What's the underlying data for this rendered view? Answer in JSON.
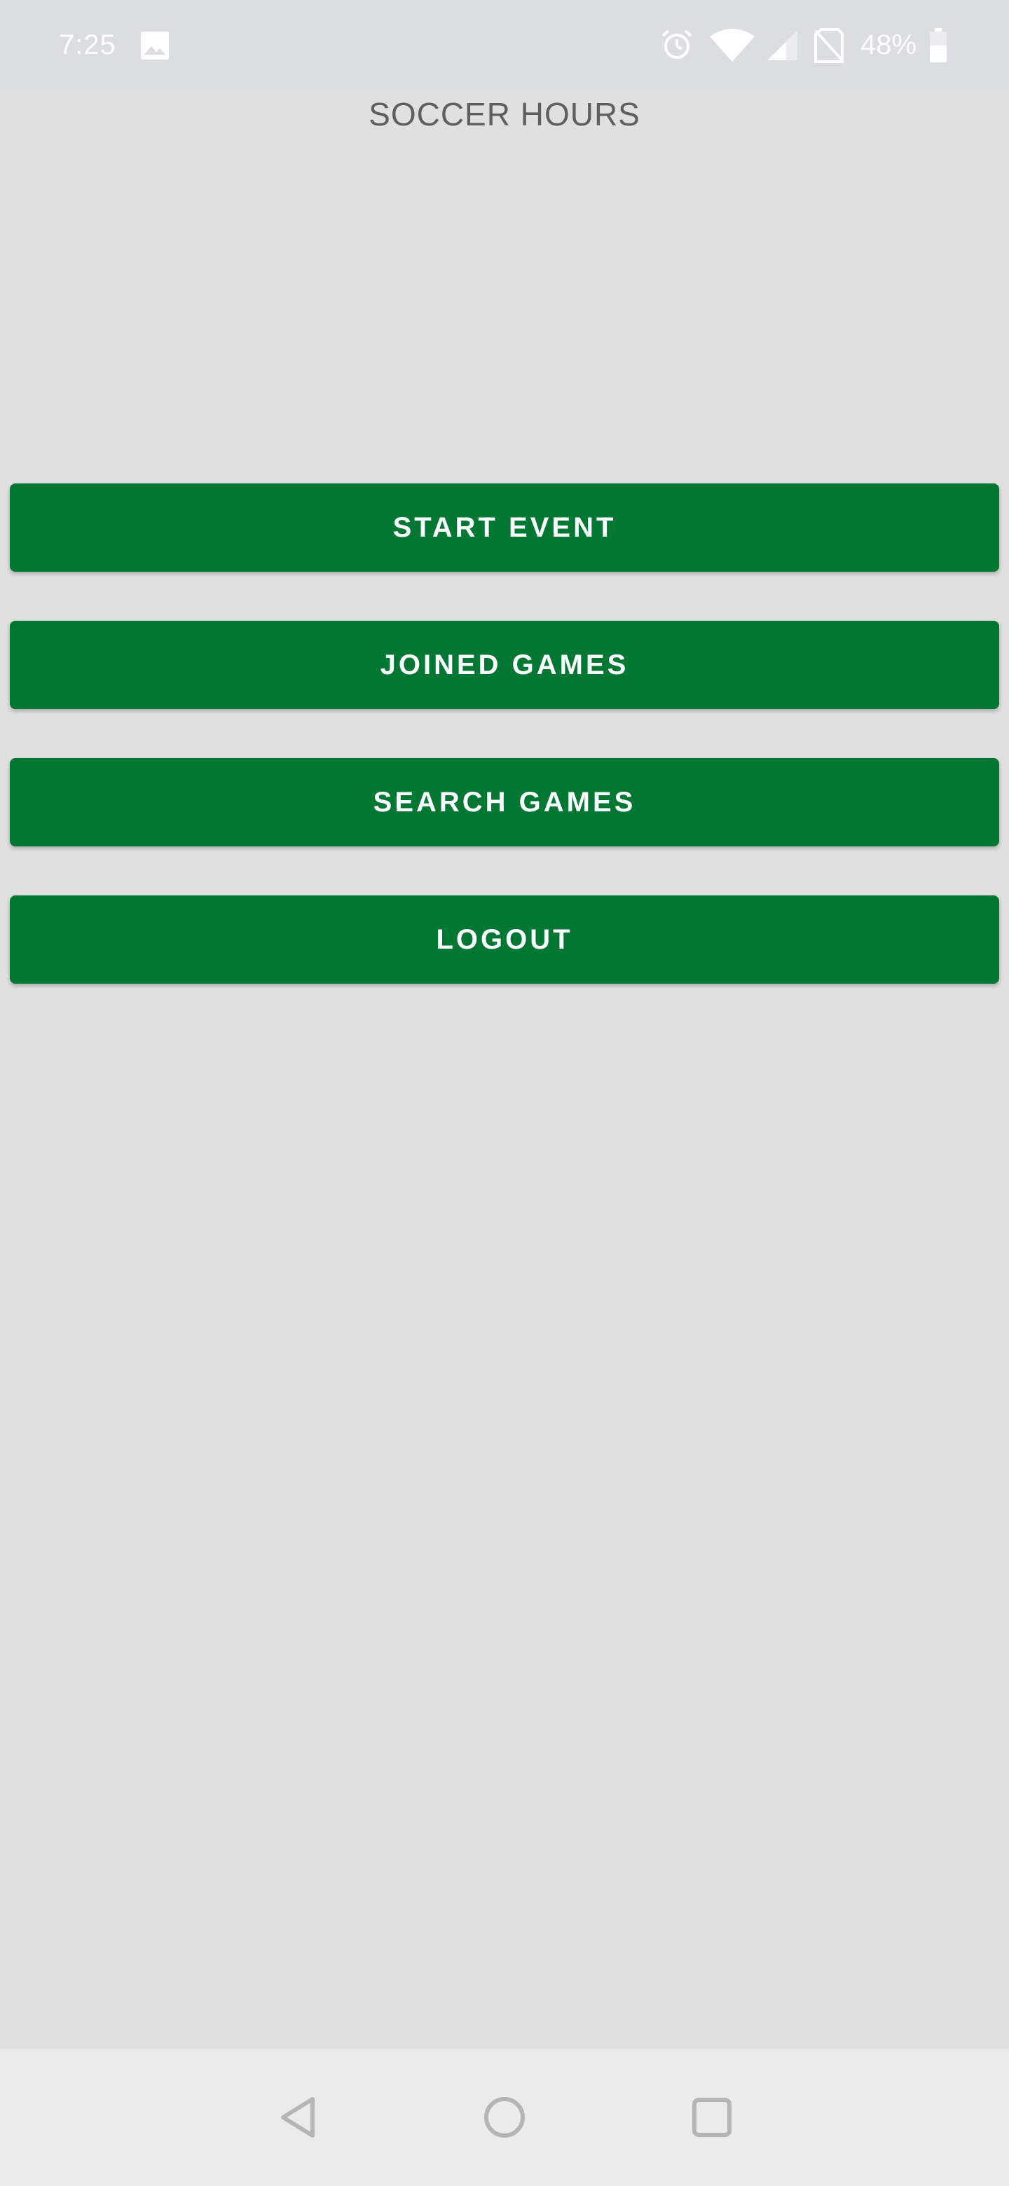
{
  "status_bar": {
    "time": "7:25",
    "battery_percent": "48%",
    "icons": [
      "image-icon",
      "alarm-icon",
      "wifi-icon",
      "signal-icon",
      "no-sim-icon",
      "battery-icon"
    ]
  },
  "app": {
    "title": "SOCCER HOURS"
  },
  "menu": {
    "start_event": "START EVENT",
    "joined_games": "JOINED GAMES",
    "search_games": "SEARCH GAMES",
    "logout": "LOGOUT"
  },
  "nav_bar": {
    "icons": [
      "back-icon",
      "home-icon",
      "recents-icon"
    ]
  },
  "colors": {
    "accent": "#007733",
    "background": "#e0e0e0",
    "title_text": "#5f5f5f"
  }
}
